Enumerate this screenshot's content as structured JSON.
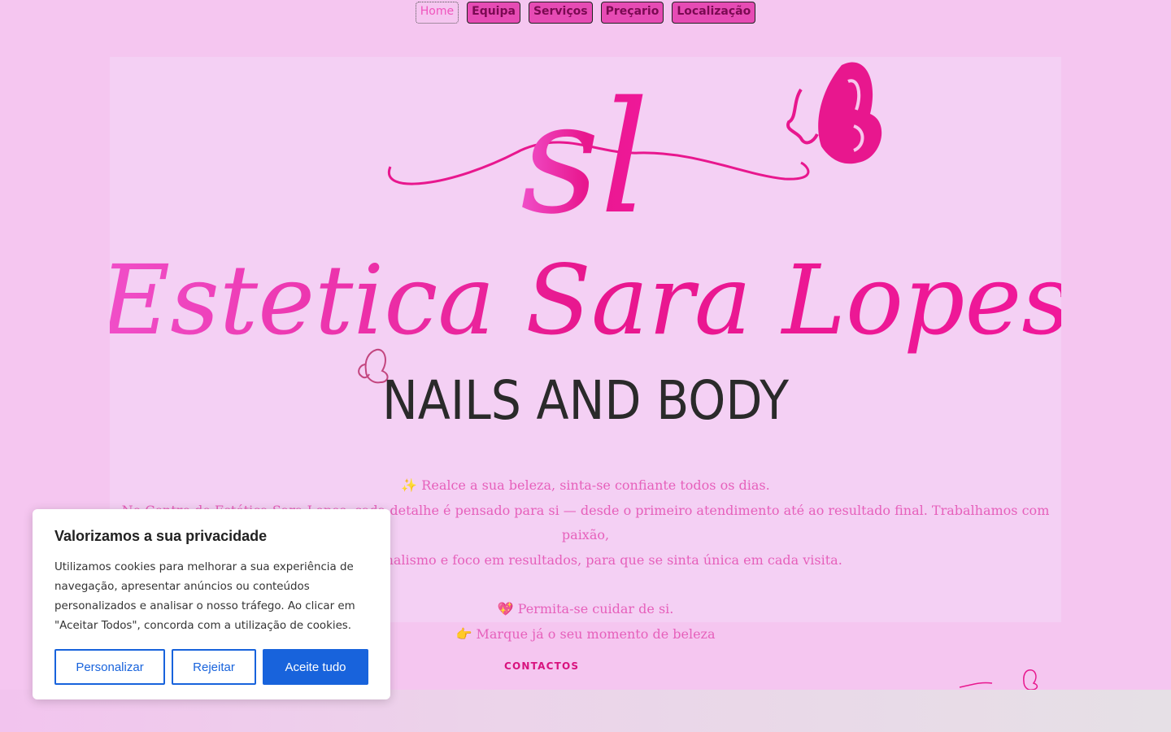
{
  "nav": {
    "items": [
      {
        "label": "Home",
        "active": true
      },
      {
        "label": "Equipa",
        "active": false
      },
      {
        "label": "Serviços",
        "active": false
      },
      {
        "label": "Preçario",
        "active": false
      },
      {
        "label": "Localização",
        "active": false
      }
    ]
  },
  "logo": {
    "monogram": "sl",
    "name": "Estetica Sara Lopes",
    "tagline": "NAILS AND BODY"
  },
  "hero": {
    "line1_emoji": "✨",
    "line1": "Realce a sua beleza, sinta-se confiante todos os dias.",
    "line2": "No Centro de Estética Sara Lopes, cada detalhe é pensado para si — desde o primeiro atendimento até ao resultado final. Trabalhamos com paixão,",
    "line3": "profissionalismo e foco em resultados, para que se sinta única em cada visita.",
    "line4_emoji": "💖",
    "line4": "Permita-se cuidar de si.",
    "line5_emoji": "👉",
    "line5": "Marque já o seu momento de beleza"
  },
  "contacts": {
    "heading": "CONTACTOS"
  },
  "cookie": {
    "title": "Valorizamos a sua privacidade",
    "text": "Utilizamos cookies para melhorar a sua experiência de navegação, apresentar anúncios ou conteúdos personalizados e analisar o nosso tráfego. Ao clicar em \"Aceitar Todos\", concorda com a utilização de cookies.",
    "customize_label": "Personalizar",
    "reject_label": "Rejeitar",
    "accept_label": "Aceite tudo"
  },
  "colors": {
    "background": "#f5c6f0",
    "hero_panel": "#f4d0f4",
    "brand_pink": "#e8178e",
    "nav_button": "#e64bb4",
    "hero_text": "#e660bb",
    "cookie_accent": "#1863dc"
  },
  "icons": {
    "logo_butterfly": "butterfly-icon",
    "tagline_butterfly": "butterfly-icon"
  }
}
